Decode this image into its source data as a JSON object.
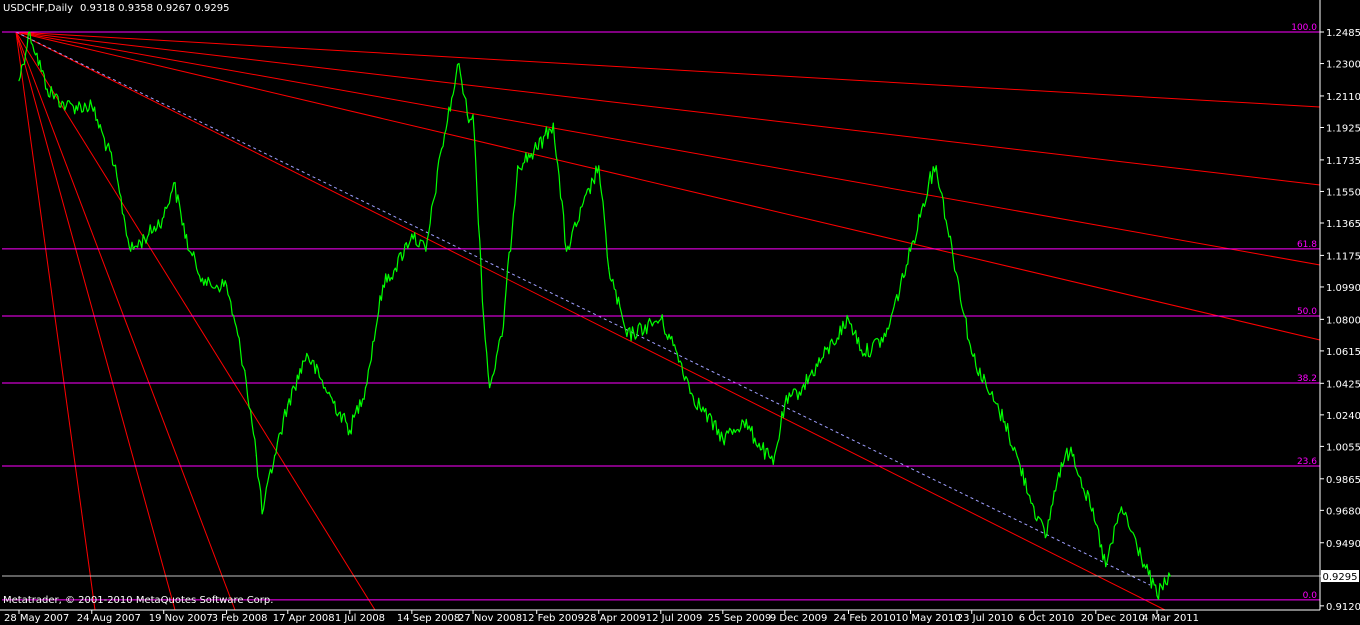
{
  "header": {
    "symbol": "USDCHF,Daily",
    "ohlc": "0.9318 0.9358 0.9267 0.9295"
  },
  "copyright": "Metatrader, © 2001-2010 MetaQuotes Software Corp.",
  "colors": {
    "background": "#000000",
    "price": "#00ff00",
    "fan": "#ff0000",
    "fib": "#ff00ff",
    "axis": "#ffffff",
    "trend_dash": "#a0a0ff"
  },
  "chart_data": {
    "type": "line",
    "title": "USDCHF,Daily",
    "ylim": [
      0.9125,
      1.2485
    ],
    "y_ticks": [
      "1.2485",
      "1.2300",
      "1.2110",
      "1.1925",
      "1.1735",
      "1.1550",
      "1.1365",
      "1.1175",
      "1.0990",
      "1.0800",
      "1.0615",
      "1.0425",
      "1.0240",
      "1.0055",
      "0.9865",
      "0.9680",
      "0.9490",
      "0.9295",
      "0.9120"
    ],
    "x_ticks": [
      "28 May 2007",
      "24 Aug 2007",
      "19 Nov 2007",
      "3 Feb 2008",
      "17 Apr 2008",
      "1 Jul 2008",
      "14 Sep 2008",
      "27 Nov 2008",
      "12 Feb 2009",
      "28 Apr 2009",
      "12 Jul 2009",
      "25 Sep 2009",
      "9 Dec 2009",
      "24 Feb 2010",
      "10 May 2010",
      "23 Jul 2010",
      "6 Oct 2010",
      "20 Dec 2010",
      "4 Mar 2011"
    ],
    "current_price": "0.9295",
    "fib_levels": [
      {
        "label": "100.0",
        "value": 1.2485
      },
      {
        "label": "61.8",
        "value": 1.1213
      },
      {
        "label": "50.0",
        "value": 1.082
      },
      {
        "label": "38.2",
        "value": 1.0427
      },
      {
        "label": "23.6",
        "value": 0.994
      },
      {
        "label": "0.0",
        "value": 0.9155
      }
    ],
    "series": [
      {
        "points": [
          [
            "28 May 2007",
            1.22
          ],
          [
            "10 Jun 2007",
            1.2485
          ],
          [
            "1 Jul 2007",
            1.215
          ],
          [
            "24 Jul 2007",
            1.205
          ],
          [
            "24 Aug 2007",
            1.205
          ],
          [
            "20 Sep 2007",
            1.17
          ],
          [
            "10 Oct 2007",
            1.12
          ],
          [
            "1 Nov 2007",
            1.13
          ],
          [
            "19 Nov 2007",
            1.14
          ],
          [
            "1 Dec 2007",
            1.16
          ],
          [
            "20 Dec 2007",
            1.12
          ],
          [
            "10 Jan 2008",
            1.1
          ],
          [
            "3 Feb 2008",
            1.1
          ],
          [
            "25 Feb 2008",
            1.05
          ],
          [
            "10 Mar 2008",
            1.0
          ],
          [
            "17 Mar 2008",
            0.966
          ],
          [
            "1 Apr 2008",
            1.0
          ],
          [
            "17 Apr 2008",
            1.03
          ],
          [
            "10 May 2008",
            1.06
          ],
          [
            "1 Jun 2008",
            1.04
          ],
          [
            "1 Jul 2008",
            1.015
          ],
          [
            "20 Jul 2008",
            1.04
          ],
          [
            "10 Aug 2008",
            1.1
          ],
          [
            "25 Aug 2008",
            1.11
          ],
          [
            "14 Sep 2008",
            1.13
          ],
          [
            "1 Oct 2008",
            1.12
          ],
          [
            "20 Oct 2008",
            1.18
          ],
          [
            "10 Nov 2008",
            1.23
          ],
          [
            "20 Nov 2008",
            1.2
          ],
          [
            "27 Nov 2008",
            1.2
          ],
          [
            "10 Dec 2008",
            1.08
          ],
          [
            "17 Dec 2008",
            1.04
          ],
          [
            "1 Jan 2009",
            1.07
          ],
          [
            "20 Jan 2009",
            1.17
          ],
          [
            "12 Feb 2009",
            1.18
          ],
          [
            "4 Mar 2009",
            1.195
          ],
          [
            "20 Mar 2009",
            1.12
          ],
          [
            "28 Apr 2009",
            1.17
          ],
          [
            "10 May 2009",
            1.11
          ],
          [
            "1 Jun 2009",
            1.07
          ],
          [
            "12 Jul 2009",
            1.08
          ],
          [
            "1 Aug 2009",
            1.06
          ],
          [
            "20 Aug 2009",
            1.035
          ],
          [
            "25 Sep 2009",
            1.01
          ],
          [
            "20 Oct 2009",
            1.02
          ],
          [
            "25 Nov 2009",
            0.995
          ],
          [
            "9 Dec 2009",
            1.03
          ],
          [
            "30 Dec 2009",
            1.04
          ],
          [
            "24 Feb 2010",
            1.08
          ],
          [
            "15 Mar 2010",
            1.06
          ],
          [
            "10 Apr 2010",
            1.07
          ],
          [
            "10 May 2010",
            1.12
          ],
          [
            "1 Jun 2010",
            1.16
          ],
          [
            "10 Jun 2010",
            1.17
          ],
          [
            "23 Jul 2010",
            1.06
          ],
          [
            "10 Aug 2010",
            1.04
          ],
          [
            "1 Sep 2010",
            1.02
          ],
          [
            "6 Oct 2010",
            0.97
          ],
          [
            "20 Oct 2010",
            0.952
          ],
          [
            "5 Nov 2010",
            0.99
          ],
          [
            "20 Nov 2010",
            1.005
          ],
          [
            "20 Dec 2010",
            0.96
          ],
          [
            "1 Jan 2011",
            0.935
          ],
          [
            "20 Jan 2011",
            0.97
          ],
          [
            "4 Mar 2011",
            0.918
          ],
          [
            "20 Mar 2011",
            0.9295
          ]
        ]
      }
    ]
  }
}
